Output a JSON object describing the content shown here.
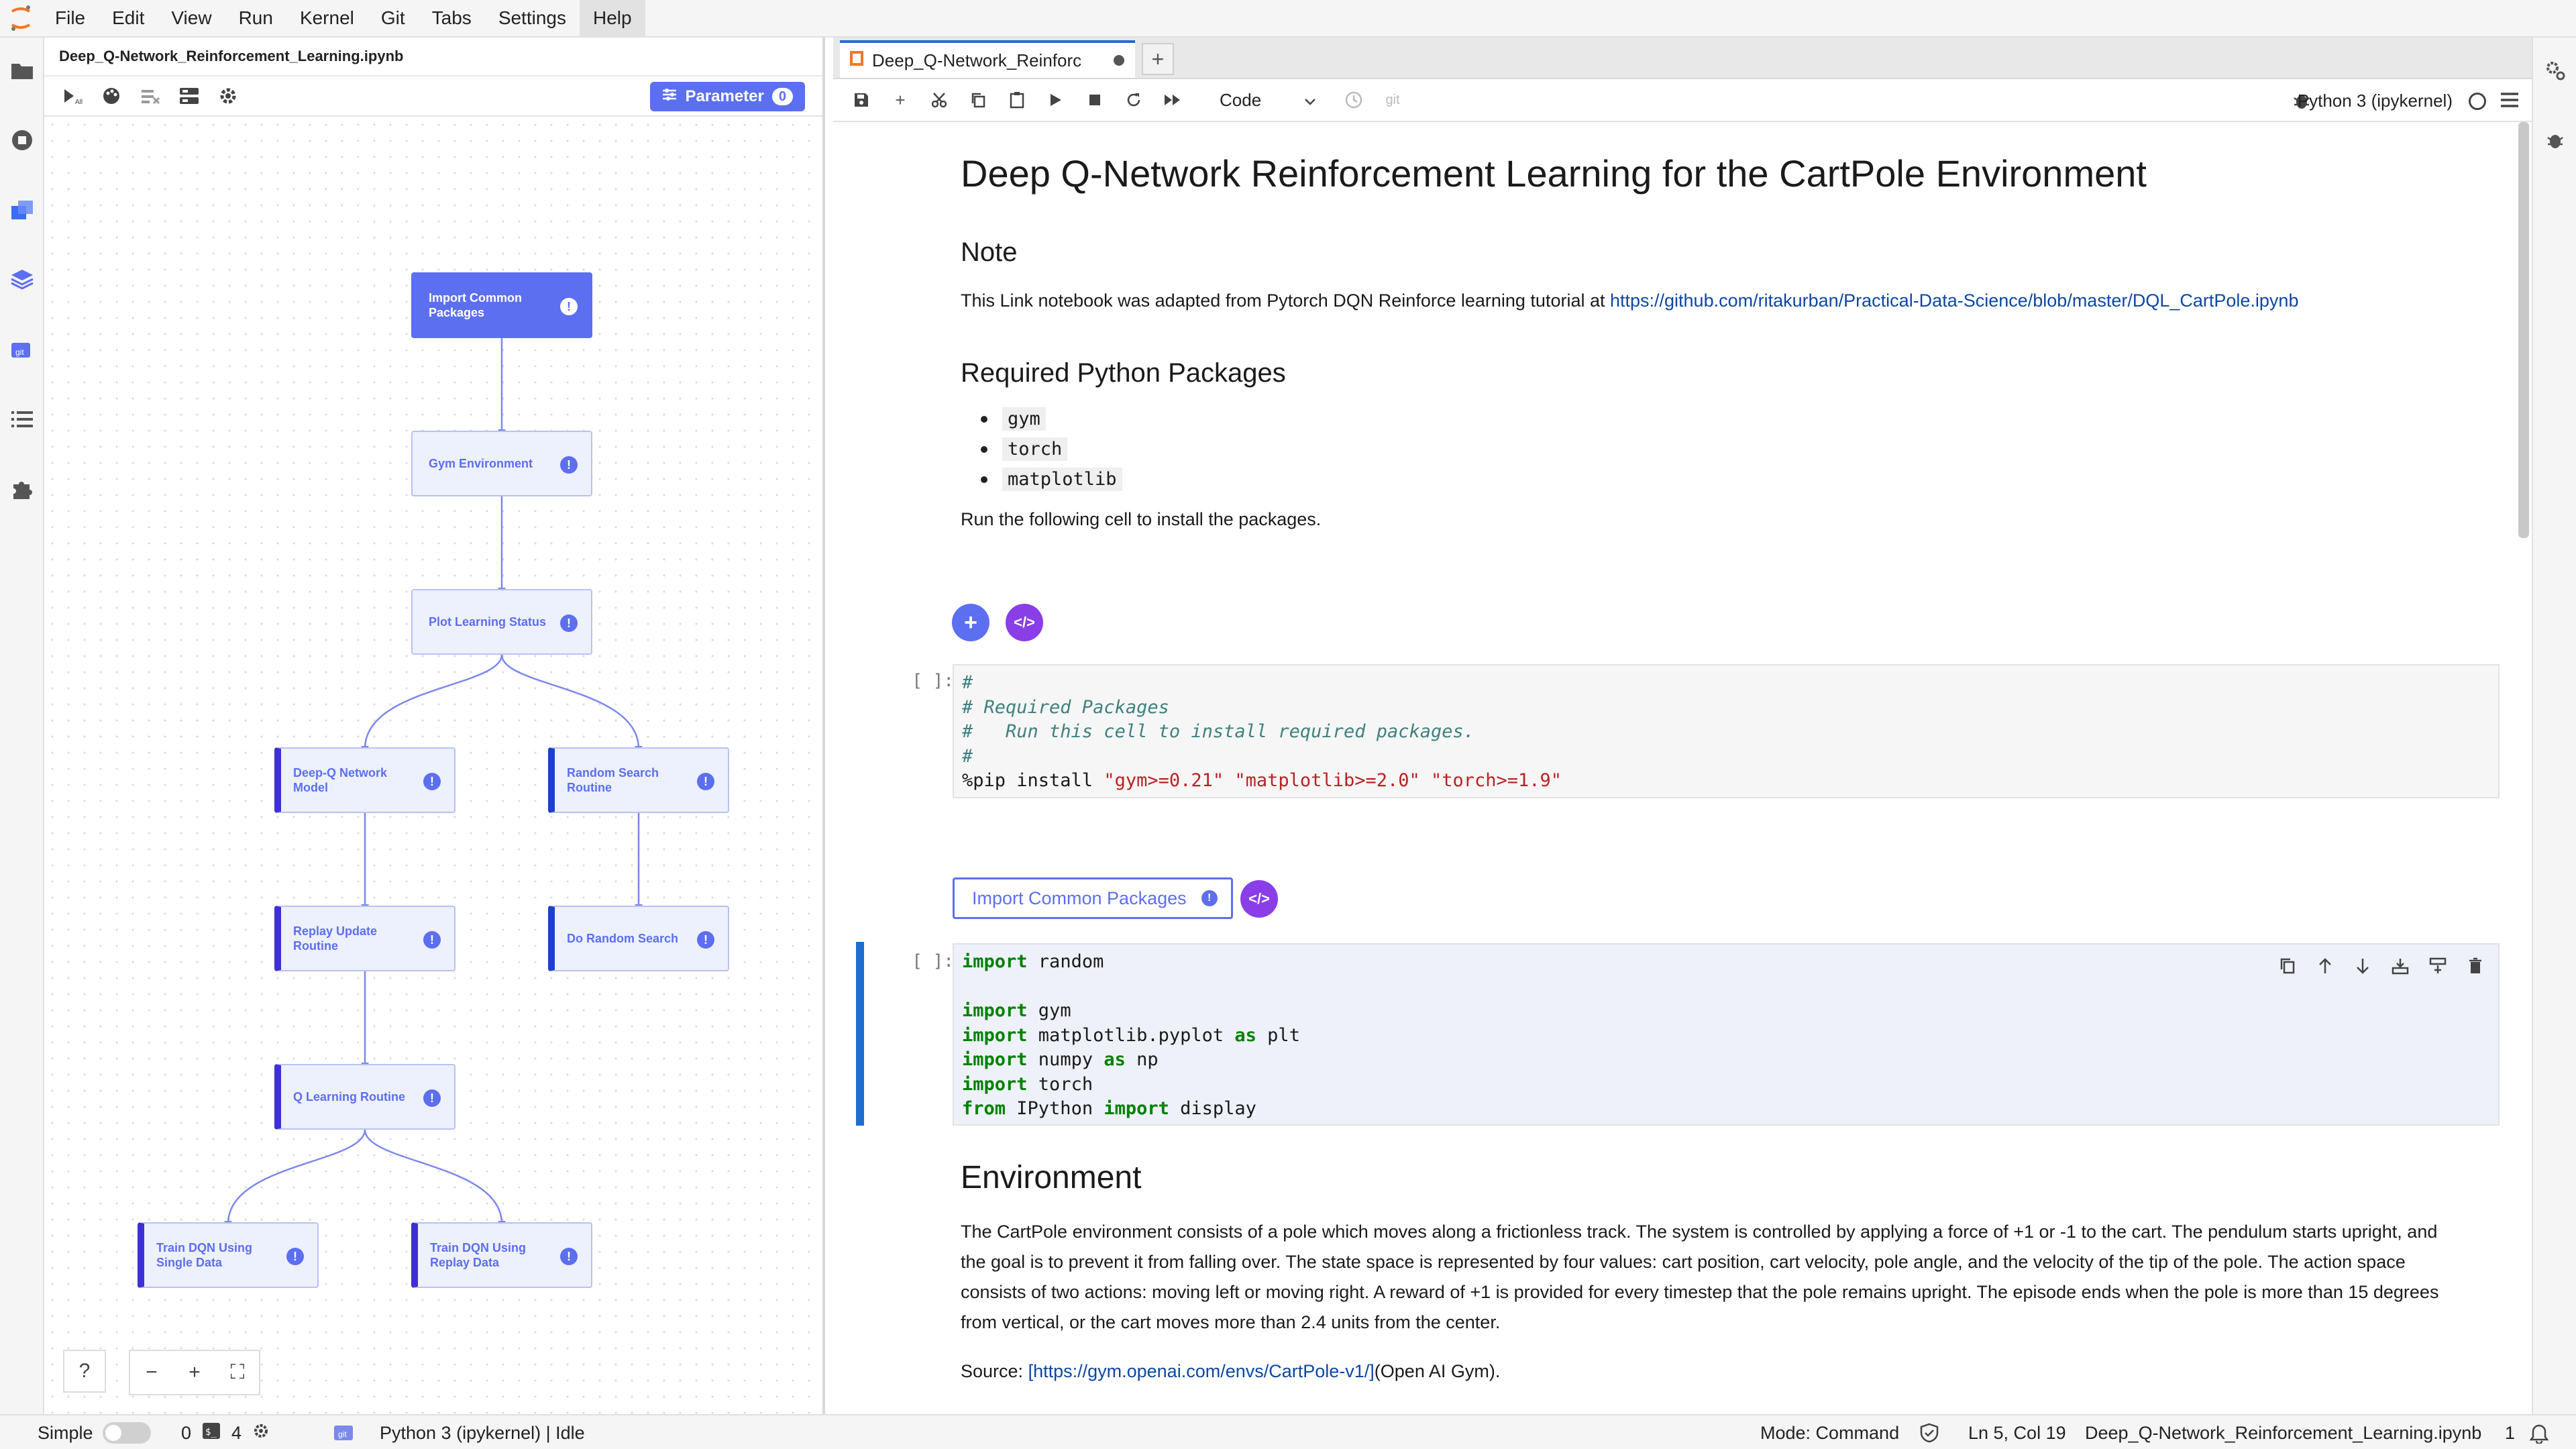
{
  "menu": [
    "File",
    "Edit",
    "View",
    "Run",
    "Kernel",
    "Git",
    "Tabs",
    "Settings",
    "Help"
  ],
  "pipeline": {
    "file_title": "Deep_Q-Network_Reinforcement_Learning.ipynb",
    "parameter_label": "Parameter",
    "parameter_count": "0",
    "nodes": [
      {
        "label": "Import Common Packages"
      },
      {
        "label": "Gym Environment"
      },
      {
        "label": "Plot Learning Status"
      },
      {
        "label": "Deep-Q Network Model"
      },
      {
        "label": "Random Search Routine"
      },
      {
        "label": "Replay Update Routine"
      },
      {
        "label": "Do Random Search"
      },
      {
        "label": "Q Learning Routine"
      },
      {
        "label": "Train DQN Using Single Data"
      },
      {
        "label": "Train DQN Using Replay Data"
      }
    ],
    "zoom": {
      "help": "?",
      "minus": "−",
      "plus": "+",
      "fit": "⛶"
    }
  },
  "notebook": {
    "tab_label": "Deep_Q-Network_Reinforc",
    "cell_type": "Code",
    "git_label": "git",
    "kernel": "Python 3 (ipykernel)",
    "title": "Deep Q-Network Reinforcement Learning for the CartPole Environment",
    "note_heading": "Note",
    "note_text": "This Link notebook was adapted from Pytorch DQN Reinforce learning tutorial at ",
    "note_link": "https://github.com/ritakurban/Practical-Data-Science/blob/master/DQL_CartPole.ipynb",
    "req_heading": "Required Python Packages",
    "packages": [
      "gym",
      "torch",
      "matplotlib"
    ],
    "run_text": "Run the following cell to install the packages.",
    "prompt1": "[ ]:",
    "code1": [
      {
        "t": "#",
        "c": "cm"
      },
      {
        "t": "# Required Packages",
        "c": "cm"
      },
      {
        "t": "#   Run this cell to install required packages.",
        "c": "cm"
      },
      {
        "t": "#",
        "c": "cm"
      }
    ],
    "code1_pip_prefix": "%pip install ",
    "code1_pip_args": "\"gym>=0.21\" \"matplotlib>=2.0\" \"torch>=1.9\"",
    "import_button": "Import Common Packages",
    "prompt2": "[ ]:",
    "code2": {
      "l1_kw": "import",
      "l1_rest": " random",
      "l2_kw": "import",
      "l2_rest": " gym",
      "l3_kw": "import",
      "l3_mid": " matplotlib.pyplot ",
      "l3_kw2": "as",
      "l3_rest": " plt",
      "l4_kw": "import",
      "l4_mid": " numpy ",
      "l4_kw2": "as",
      "l4_rest": " np",
      "l5_kw": "import",
      "l5_rest": " torch",
      "l6_kw": "from",
      "l6_mid": " IPython ",
      "l6_kw2": "import",
      "l6_rest": " display"
    },
    "env_heading": "Environment",
    "env_text": "The CartPole environment consists of a pole which moves along a frictionless track. The system is controlled by applying a force of +1 or -1 to the cart. The pendulum starts upright, and the goal is to prevent it from falling over. The state space is represented by four values: cart position, cart velocity, pole angle, and the velocity of the tip of the pole. The action space consists of two actions: moving left or moving right. A reward of +1 is provided for every timestep that the pole remains upright. The episode ends when the pole is more than 15 degrees from vertical, or the cart moves more than 2.4 units from the center.",
    "source_prefix": "Source: ",
    "source_link": "[https://gym.openai.com/envs/CartPole-v1/]",
    "source_suffix": "(Open AI Gym)."
  },
  "status": {
    "mode_simple": "Simple",
    "count_a": "0",
    "count_b": "4",
    "kernel_state": "Python 3 (ipykernel) | Idle",
    "mode": "Mode: Command",
    "position": "Ln 5, Col 19",
    "file": "Deep_Q-Network_Reinforcement_Learning.ipynb",
    "notifications": "1"
  },
  "colors": {
    "accent": "#5c6ff0",
    "purple": "#8a3ee8",
    "active_blue": "#1f6dd1"
  }
}
